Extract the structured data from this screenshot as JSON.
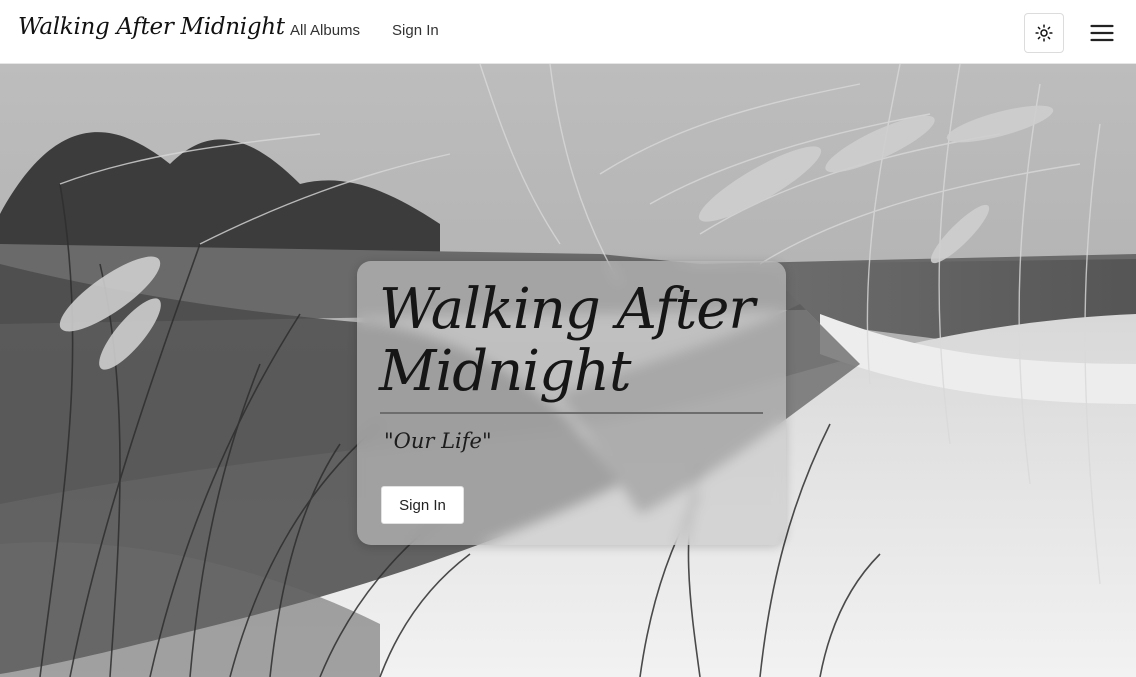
{
  "navbar": {
    "brand": "Walking After Midnight",
    "links": [
      {
        "label": "All Albums"
      },
      {
        "label": "Sign In"
      }
    ],
    "theme_toggle_icon": "sun-icon",
    "menu_icon": "hamburger-menu-icon"
  },
  "hero": {
    "background_image": "black-and-white beach dunes with sea oats grass",
    "card": {
      "title": "Walking After Midnight",
      "subtitle": "\"Our Life\"",
      "button_label": "Sign In"
    }
  },
  "colors": {
    "navbar_bg": "#ffffff",
    "card_bg": "rgba(200,200,200,0.62)",
    "text": "#161616"
  }
}
